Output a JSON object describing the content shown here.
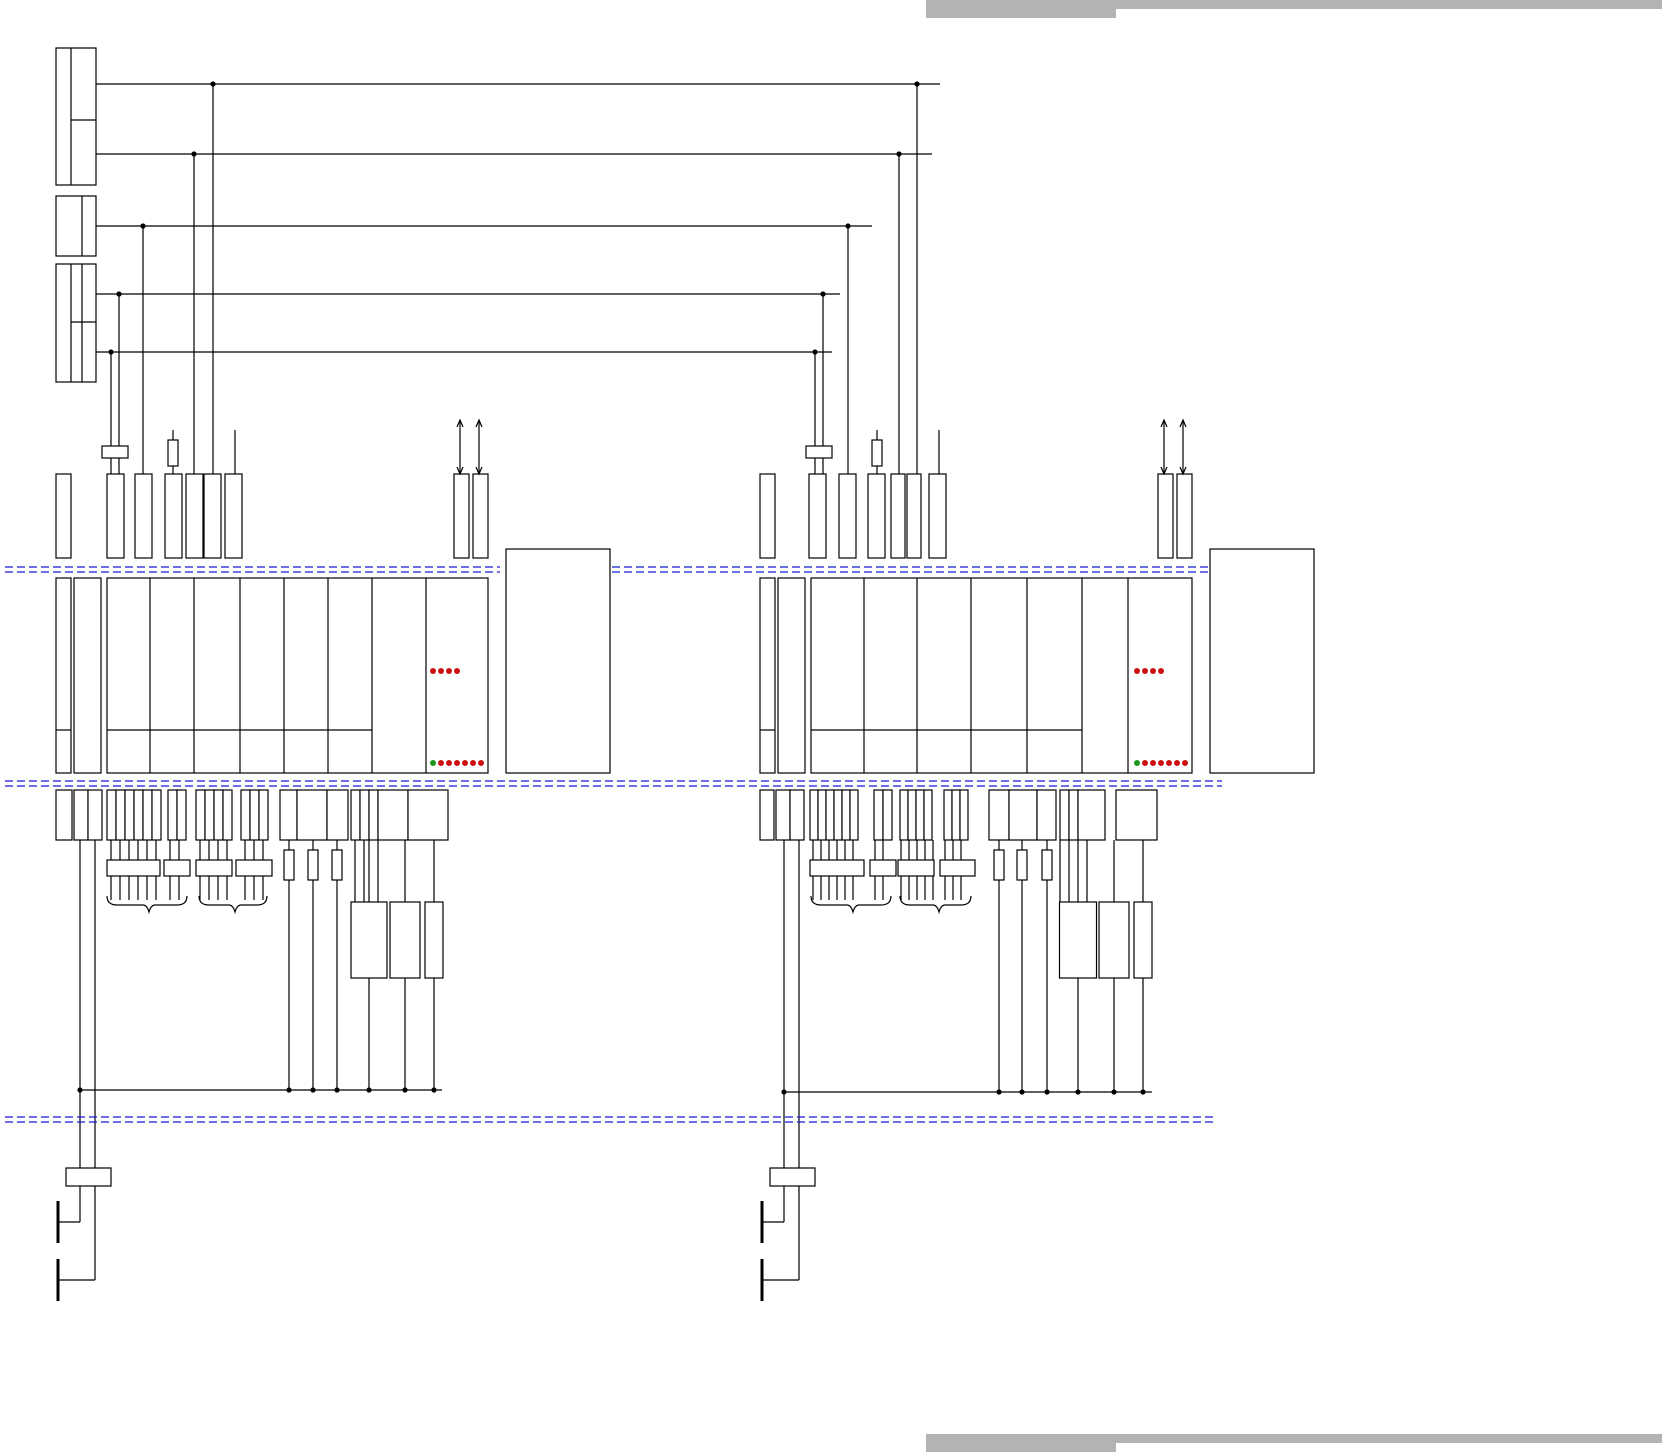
{
  "colors": {
    "line": "#000000",
    "dashed_separator": "#1a1ad6",
    "header_bar": "#b3b3b3",
    "lamp_red": "#cc1111",
    "lamp_green": "#1a9a1a"
  },
  "units": [
    {
      "id": "left",
      "status_lamps": [
        "red",
        "red",
        "red",
        "red"
      ],
      "state_lamps": [
        "green",
        "red",
        "red",
        "red",
        "red",
        "red",
        "red"
      ]
    },
    {
      "id": "right",
      "status_lamps": [
        "red",
        "red",
        "red",
        "red"
      ],
      "state_lamps": [
        "green",
        "red",
        "red",
        "red",
        "red",
        "red",
        "red"
      ]
    }
  ],
  "separators": 3
}
